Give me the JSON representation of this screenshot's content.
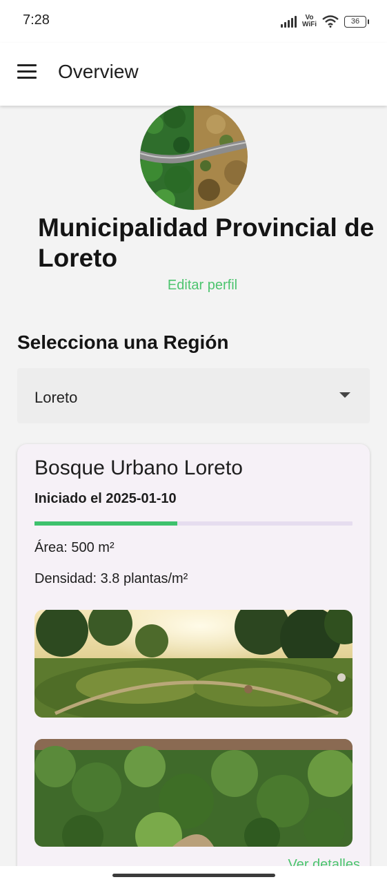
{
  "status_bar": {
    "time": "7:28",
    "vowifi_top": "Vo",
    "vowifi_bottom": "WiFi",
    "battery": "36",
    "icons": [
      "signal-icon",
      "vowifi-icon",
      "wifi-icon",
      "battery-icon"
    ]
  },
  "app_bar": {
    "title": "Overview",
    "menu_icon": "menu-icon"
  },
  "profile": {
    "name": "Municipalidad Provincial de Loreto",
    "edit_label": "Editar perfil"
  },
  "region": {
    "heading": "Selecciona una Región",
    "selected": "Loreto"
  },
  "project_card": {
    "title": "Bosque Urbano Loreto",
    "subtitle": "Iniciado el 2025-01-10",
    "progress": 0.45,
    "area": "Área: 500 m²",
    "density": "Densidad: 3.8 plantas/m²",
    "details_link": "Ver detalles"
  },
  "colors": {
    "accent": "#4cc46e",
    "progress_fill": "#3ec16d",
    "progress_track": "#e6ddef",
    "card_background": "#f6f1f7",
    "page_background": "#f3f3f3"
  }
}
